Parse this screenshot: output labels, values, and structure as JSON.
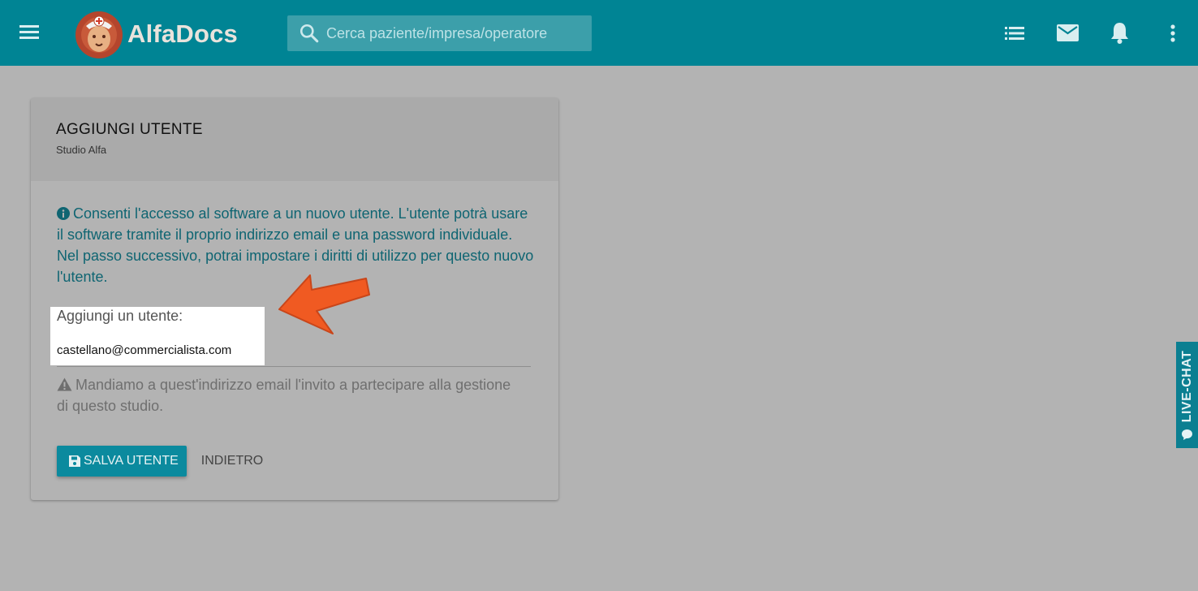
{
  "colors": {
    "toolbar": "#008494",
    "overlay": "#b3b3b3",
    "info_text": "#0f6572",
    "button": "#0b8a9e",
    "arrow": "#f05a22"
  },
  "header": {
    "logo_text": "AlfaDocs",
    "search_placeholder": "Cerca paziente/impresa/operatore",
    "icons": [
      "menu-icon",
      "list-icon",
      "mail-icon",
      "bell-icon",
      "more-vert-icon"
    ]
  },
  "card": {
    "title": "AGGIUNGI UTENTE",
    "subtitle": "Studio Alfa",
    "info_text": "Consenti l'accesso al software a un nuovo utente. L'utente potrà usare il software tramite il proprio indirizzo email e una password individuale. Nel passo successivo, potrai impostare i diritti di utilizzo per questo nuovo l'utente.",
    "field_label": "Aggiungi un utente:",
    "field_value": "castellano@commercialista.com",
    "warning_text": "Mandiamo a quest'indirizzo email l'invito a partecipare alla gestione di questo studio.",
    "save_label": "SALVA UTENTE",
    "back_label": "INDIETRO"
  },
  "livechat": {
    "label": "LIVE-CHAT"
  }
}
